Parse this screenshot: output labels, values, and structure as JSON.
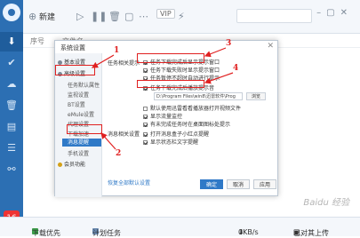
{
  "sidebar": {
    "badge": "16"
  },
  "toolbar": {
    "new_label": "新建",
    "vip_label": "VIP",
    "search_placeholder": ""
  },
  "columns": {
    "number": "序号",
    "filename": "文件名"
  },
  "dialog": {
    "title": "系统设置",
    "close_glyph": "✕",
    "nav": [
      {
        "label": "基本设置"
      },
      {
        "label": "高级设置"
      },
      {
        "label": "任务默认属性"
      },
      {
        "label": "监视设置"
      },
      {
        "label": "BT设置"
      },
      {
        "label": "eMule设置"
      },
      {
        "label": "代理设置"
      },
      {
        "label": "下载加速"
      },
      {
        "label": "消息提醒"
      },
      {
        "label": "手机设置"
      },
      {
        "label": "会员功能"
      }
    ],
    "sections": {
      "task_tip": "任务相关提示",
      "msg_settings": "消息相关设置"
    },
    "options": [
      {
        "label": "任务下载完成后显示提示窗口",
        "checked": true
      },
      {
        "label": "任务下载失败时显示提示窗口",
        "checked": true
      },
      {
        "label": "任务暂停不超时自动进行提示",
        "checked": true
      },
      {
        "label": "任务下载完成后播放提示音",
        "checked": true
      },
      {
        "label": "默认使用迅雷看看播放器打开视频文件",
        "checked": false
      },
      {
        "label": "显示流量监控",
        "checked": true
      },
      {
        "label": "有未完成任务时在桌面图标处提示",
        "checked": true
      },
      {
        "label": "打开消息盒子小红点提醒",
        "checked": true
      },
      {
        "label": "显示状态栏文字提醒",
        "checked": true
      }
    ],
    "sound_path": "D:\\Program Files\\win8\\迅雷软件\\Prog",
    "browse_label": "浏览",
    "restore_label": "恢复全部默认设置",
    "ok_label": "确定",
    "cancel_label": "取消",
    "apply_label": "应用"
  },
  "annotations": [
    "1",
    "2",
    "3",
    "4"
  ],
  "status": {
    "download_label": "下载优先",
    "plan_label": "计划任务",
    "speed": "0KB/s",
    "disk": "已对其上传"
  },
  "watermark": "Baidu 经验",
  "colors": {
    "sidebar": "#2c6fb3",
    "accent": "#2f79c7",
    "annotation": "#e02020"
  }
}
